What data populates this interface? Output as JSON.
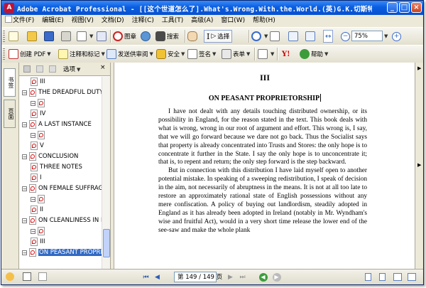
{
  "window": {
    "title": "Adobe Acrobat Professional - [[这个世道怎么了].What's.Wrong.With.the.World.(英)G.K.切斯特顿....",
    "minimize": "_",
    "maximize": "□",
    "close": "×"
  },
  "menu": {
    "items": [
      "文件(F)",
      "编辑(E)",
      "视图(V)",
      "文档(D)",
      "注释(C)",
      "工具(T)",
      "高级(A)",
      "窗口(W)",
      "帮助(H)"
    ]
  },
  "toolbar1": {
    "picture_label": "图章",
    "search_label": "搜索",
    "select_label": "选择",
    "zoom_value": "75%"
  },
  "toolbar2": {
    "create_pdf": "创建 PDF",
    "comment_markup": "注释和标记",
    "send_review": "发送供审阅",
    "secure": "安全",
    "sign": "签名",
    "forms": "表单",
    "help": "帮助"
  },
  "side_tabs": [
    "书签",
    "页面"
  ],
  "bookmarks_panel": {
    "options_label": "选项",
    "tree": [
      {
        "label": "III",
        "level": 2
      },
      {
        "label": "THE DREADFUL DUTY",
        "level": 1
      },
      {
        "label": "",
        "level": 2
      },
      {
        "label": "IV",
        "level": 2
      },
      {
        "label": "A LAST INSTANCE",
        "level": 1
      },
      {
        "label": "",
        "level": 2
      },
      {
        "label": "V",
        "level": 2
      },
      {
        "label": "CONCLUSION",
        "level": 1
      },
      {
        "label": "THREE NOTES",
        "level": 2
      },
      {
        "label": "I",
        "level": 2
      },
      {
        "label": "ON FEMALE SUFFRAG",
        "level": 1
      },
      {
        "label": "",
        "level": 2
      },
      {
        "label": "II",
        "level": 2
      },
      {
        "label": "ON CLEANLINESS IN E",
        "level": 1
      },
      {
        "label": "",
        "level": 2
      },
      {
        "label": "III",
        "level": 2
      },
      {
        "label": "ON PEASANT PROPRI",
        "level": 1,
        "selected": true
      }
    ]
  },
  "document": {
    "page_heading": "III",
    "chapter_title": "ON PEASANT PROPRIETORSHIP",
    "paragraphs": [
      "I have not dealt with any details touching distributed ownership, or its possibility in England, for the reason stated in the text. This book deals with what is wrong, wrong in our root of argument and effort. This wrong is, I say, that we will go forward because we dare not go back. Thus the Socialist says that property is already concentrated into Trusts and Stores: the only hope is to concentrate it further in the State. I say the only hope is to unconcentrate it; that is, to repent and return; the only step forward is the step backward.",
      "But in connection with this distribution I have laid myself open to another potential mistake. In speaking of a sweeping redistribution, I speak of decision in the aim, not necessarily of abruptness in the means. It is not at all too late to restore an approximately rational state of English possessions without any mere confiscation. A policy of buying out landlordism, steadily adopted in England as it has already been adopted in Ireland (notably in Mr. Wyndham's wise and fruitful Act), would in a very short time release the lower end of the see-saw and make the whole plank"
    ]
  },
  "statusbar": {
    "page_display": "第 149 / 149 页"
  }
}
